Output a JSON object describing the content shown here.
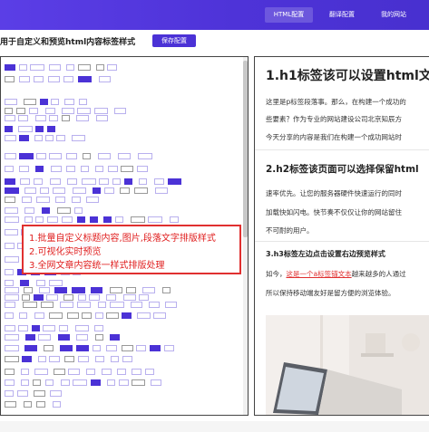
{
  "nav": {
    "items": [
      {
        "label": "HTML配置",
        "active": true
      },
      {
        "label": "翻译配置",
        "active": false
      },
      {
        "label": "我的网站",
        "active": false
      }
    ]
  },
  "toolbar": {
    "title": "用于自定义和预览html内容标签样式",
    "save_label": "保存配置"
  },
  "callout": {
    "lines": [
      "1.批量自定义标题内容,图片,段落文字排版样式",
      "2.可视化实时预览",
      "3.全网文章内容统一样式排版处理"
    ]
  },
  "preview": {
    "h1": "1.h1标签该可以设置html文",
    "p1_lines": [
      "这里是p标签段落事。那么，在构建一个成功的",
      "些要素？作为专业的网站建设公司北京知辰方",
      "今天分享的内容是我们在构建一个成功网站时"
    ],
    "h2": "2.h2标签该页面可以选择保留html",
    "p2_lines": [
      "速率优先。让您的服务器硬件快速运行的同时",
      "加载快如闪电。快节奏不仅仅让你的网站留住",
      "不可耐的用户。"
    ],
    "h3": "3.h3标签左边点击设置右边预览样式",
    "p3_prefix": "如今，",
    "p3_link": "这是一个a标签锚文本",
    "p3_suffix": "越来越多的人通过",
    "p3_line2": "所以保持移动端友好是留方便的浏览体验。"
  },
  "colors": {
    "brand": "#4b32d6",
    "callout": "#e02020"
  }
}
